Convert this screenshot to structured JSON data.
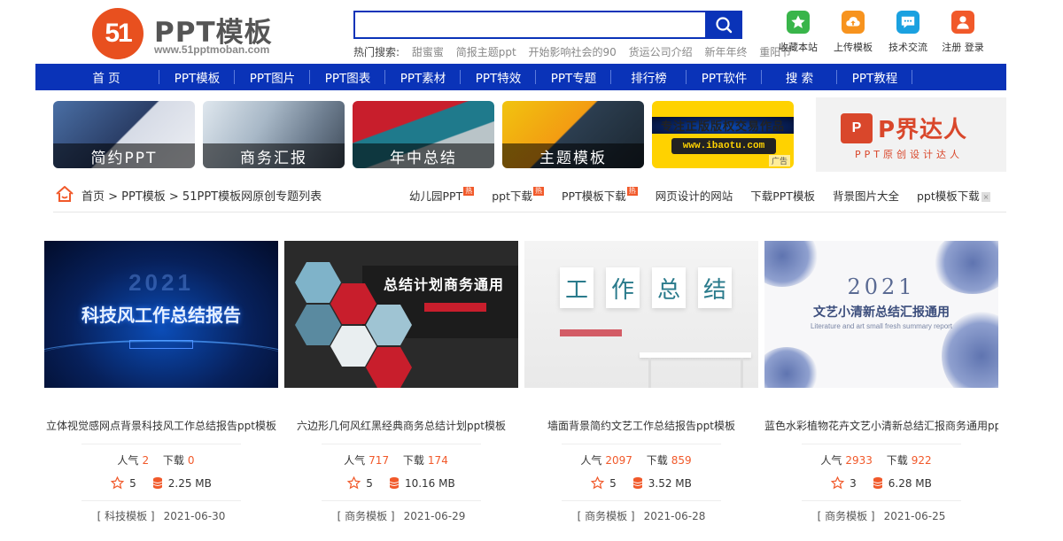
{
  "logo": {
    "mark": "51",
    "title": "PPT模板",
    "url": "www.51pptmoban.com"
  },
  "search": {
    "value": "",
    "placeholder": ""
  },
  "hot_search": {
    "label": "热门搜索:",
    "keywords": [
      "甜蜜蜜",
      "简报主题ppt",
      "开始影响社会的90",
      "货运公司介绍",
      "新年年终",
      "重阳节"
    ]
  },
  "top_icons": [
    {
      "icon": "star-icon",
      "label": "收藏本站",
      "color": "#39b54a"
    },
    {
      "icon": "upload-cloud-icon",
      "label": "上传模板",
      "color": "#f7931e"
    },
    {
      "icon": "chat-icon",
      "label": "技术交流",
      "color": "#1aa1e0"
    },
    {
      "icon": "user-icon",
      "label": "注册 登录",
      "color": "#f1592a"
    }
  ],
  "nav": [
    "首 页",
    "PPT模板",
    "PPT图片",
    "PPT图表",
    "PPT素材",
    "PPT特效",
    "PPT专题",
    "排行榜",
    "PPT软件",
    "搜 索",
    "PPT教程"
  ],
  "banners": [
    {
      "caption": "简约PPT"
    },
    {
      "caption": "商务汇报"
    },
    {
      "caption": "年中总结"
    },
    {
      "caption": "主题模板"
    },
    {
      "headline": "专注正版版权交易作品",
      "url": "www.ibaotu.com",
      "ad": "广告"
    }
  ],
  "side_ad": {
    "badge": "P",
    "brand": "P界达人",
    "sub": "PPT原创设计达人"
  },
  "breadcrumb": "首页 > PPT模板 > 51PPT模板网原创专题列表",
  "quick_links": [
    {
      "label": "幼儿园PPT",
      "hot": "热"
    },
    {
      "label": "ppt下载",
      "hot": "热"
    },
    {
      "label": "PPT模板下载",
      "hot": "热"
    },
    {
      "label": "网页设计的网站",
      "hot": ""
    },
    {
      "label": "下载PPT模板",
      "hot": ""
    },
    {
      "label": "背景图片大全",
      "hot": ""
    },
    {
      "label": "ppt模板下载",
      "hot": "",
      "close": "×"
    }
  ],
  "cards": [
    {
      "title": "立体视觉感网点背景科技风工作总结报告ppt模板",
      "views_label": "人气",
      "views": "2",
      "downloads_label": "下载",
      "downloads": "0",
      "rating": "5",
      "size": "2.25 MB",
      "category": "[ 科技模板 ]",
      "date": "2021-06-30",
      "thumb": {
        "year": "2021",
        "headline": "科技风工作总结报告"
      }
    },
    {
      "title": "六边形几何风红黑经典商务总结计划ppt模板",
      "views_label": "人气",
      "views": "717",
      "downloads_label": "下载",
      "downloads": "174",
      "rating": "5",
      "size": "10.16 MB",
      "category": "[ 商务模板 ]",
      "date": "2021-06-29",
      "thumb": {
        "headline": "总结计划商务通用"
      }
    },
    {
      "title": "墙面背景简约文艺工作总结报告ppt模板",
      "views_label": "人气",
      "views": "2097",
      "downloads_label": "下载",
      "downloads": "859",
      "rating": "5",
      "size": "3.52 MB",
      "category": "[ 商务模板 ]",
      "date": "2021-06-28",
      "thumb": {
        "chars": [
          "工",
          "作",
          "总",
          "结"
        ]
      }
    },
    {
      "title": "蓝色水彩植物花卉文艺小清新总结汇报商务通用ppt",
      "views_label": "人气",
      "views": "2933",
      "downloads_label": "下载",
      "downloads": "922",
      "rating": "3",
      "size": "6.28 MB",
      "category": "[ 商务模板 ]",
      "date": "2021-06-25",
      "thumb": {
        "year": "2021",
        "headline": "文艺小清新总结汇报通用",
        "sub": "Literature and art small fresh summary report"
      }
    }
  ]
}
